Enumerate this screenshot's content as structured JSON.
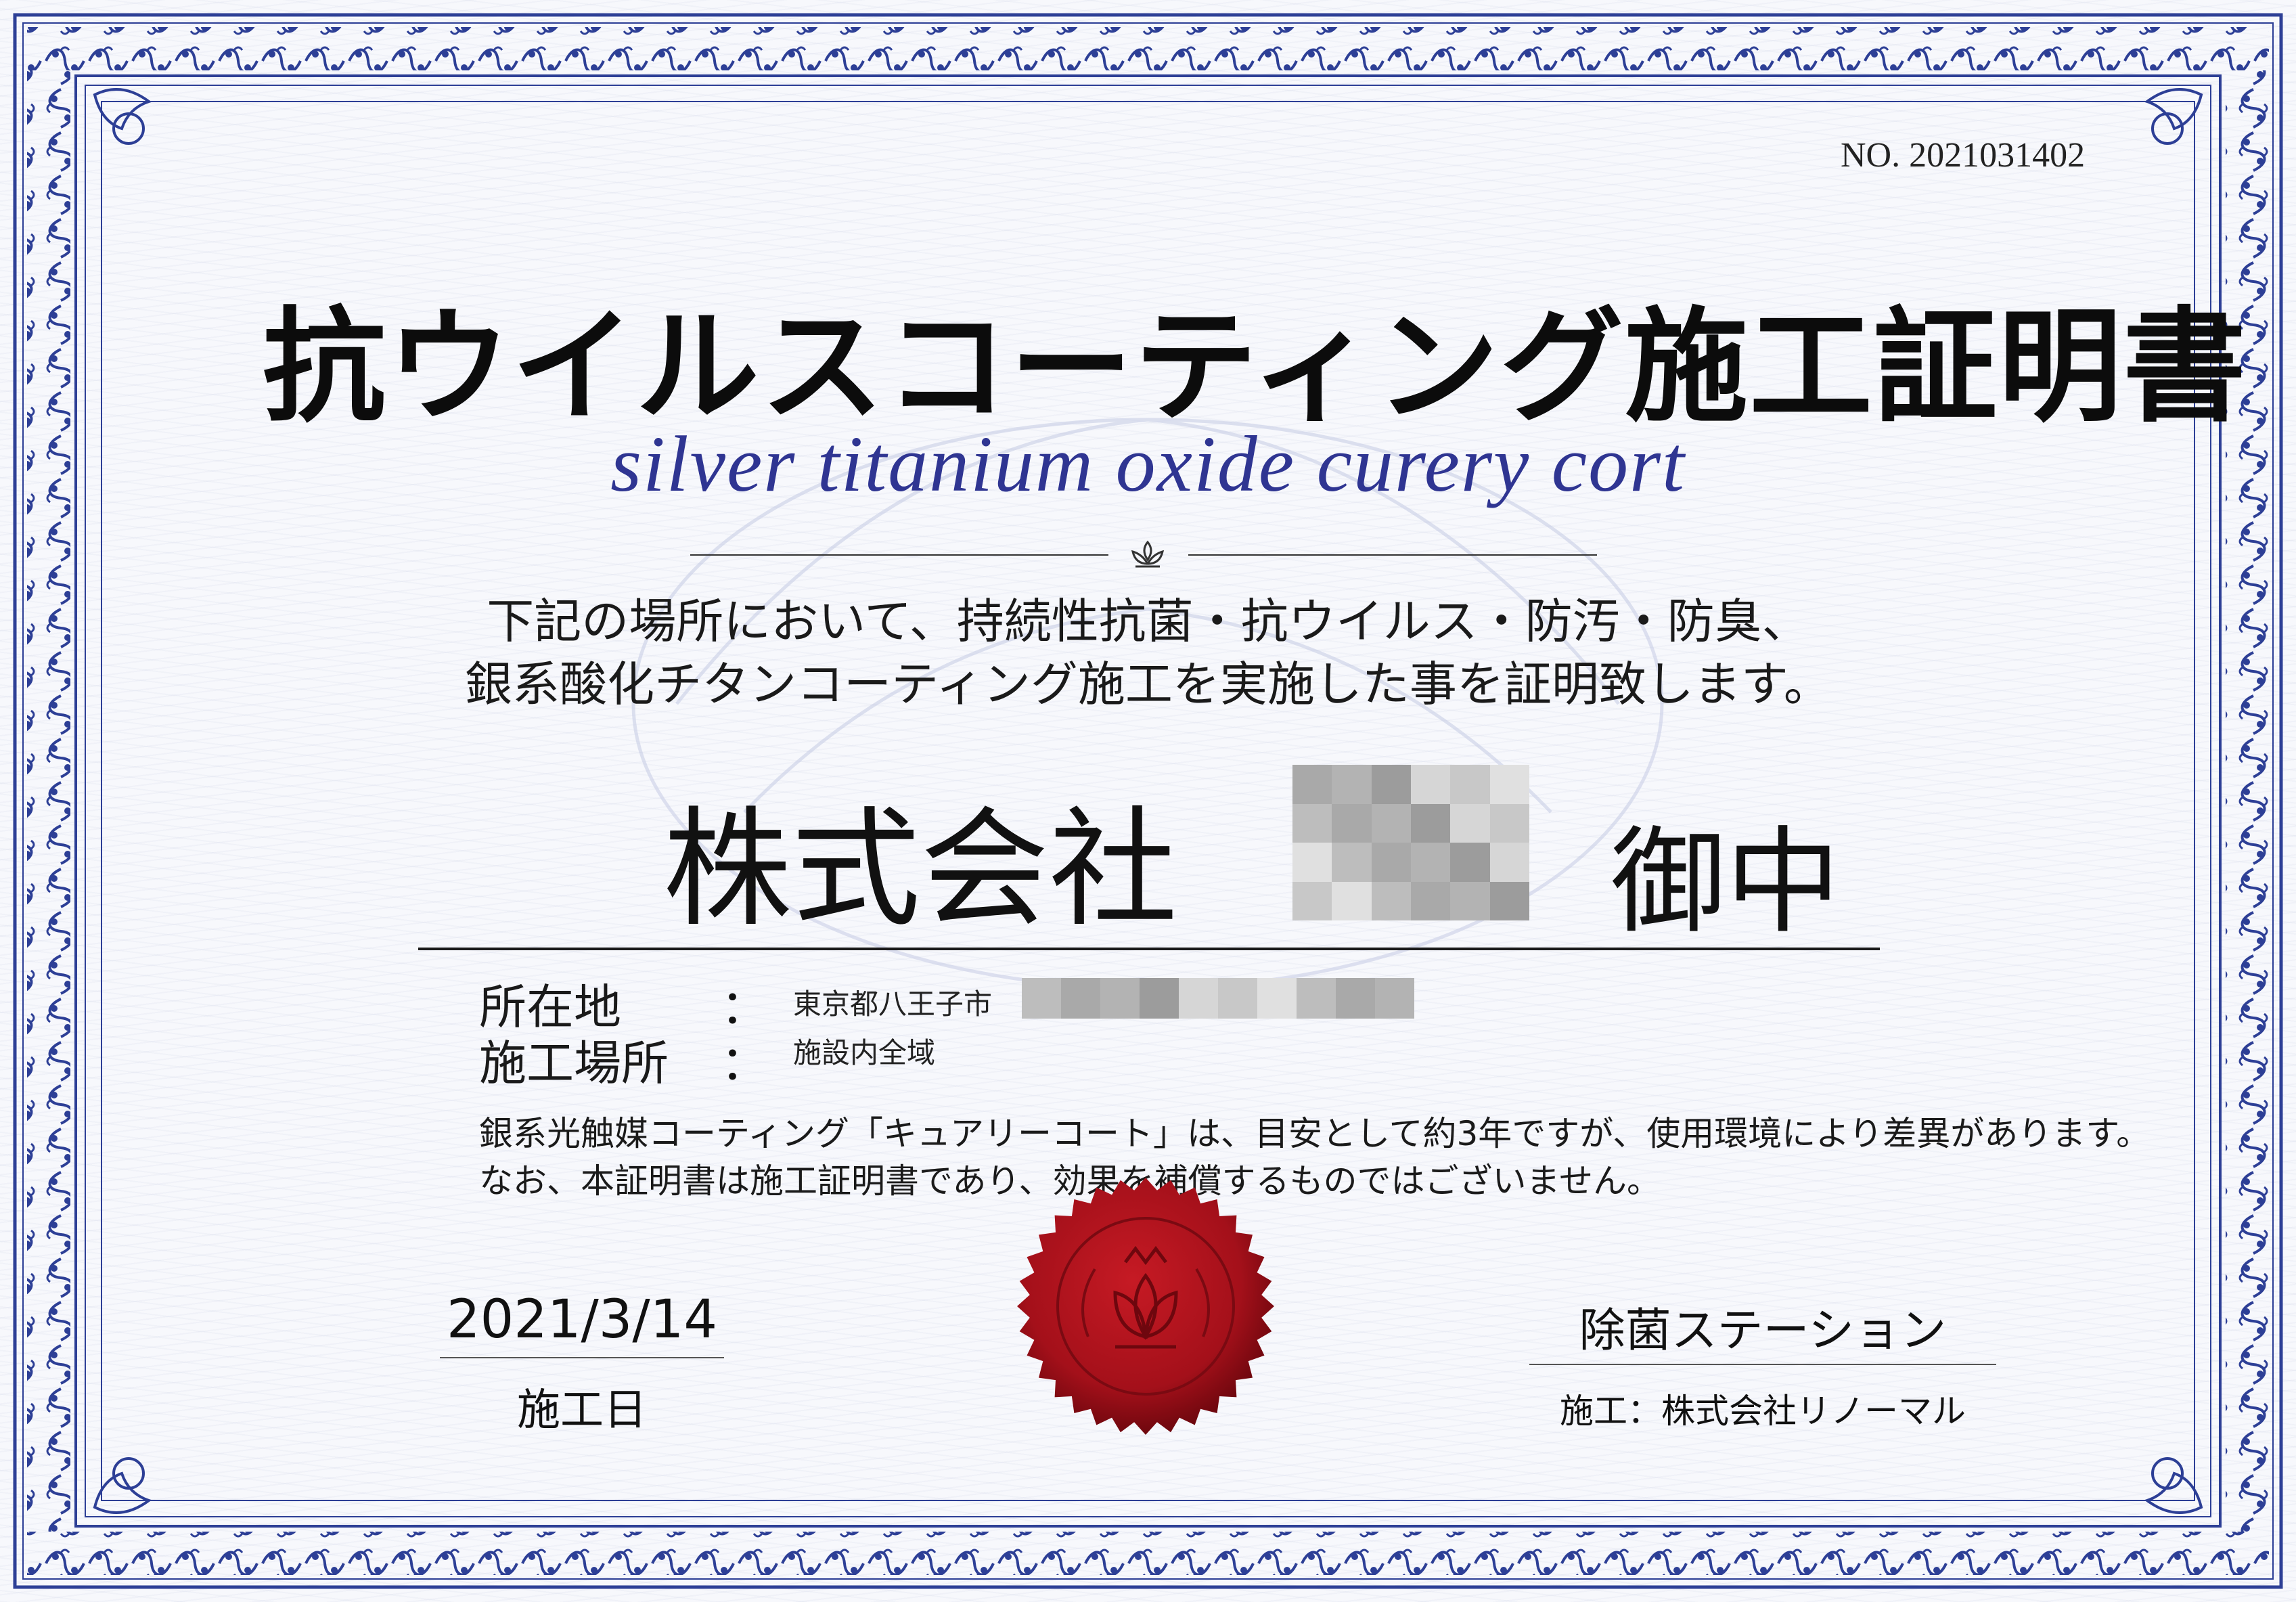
{
  "certificate": {
    "number": "NO. 2021031402",
    "title": "抗ウイルスコーティング施工証明書",
    "subtitle": "silver titanium oxide curery cort",
    "body_line1": "下記の場所において、持続性抗菌・抗ウイルス・防汚・防臭、",
    "body_line2": "銀系酸化チタンコーティング施工を実施した事を証明致します。",
    "company_prefix": "株式会社",
    "honorific": "御中",
    "location_label": "所在地",
    "location_value": "東京都八王子市",
    "site_label": "施工場所",
    "site_value": "施設内全域",
    "colon": "：",
    "note_line1": "銀系光触媒コーティング「キュアリーコート」は、目安として約3年ですが、使用環境により差異があります。",
    "note_line2": "なお、本証明書は施工証明書であり、効果を補償するものではございません。",
    "date": "2021/3/14",
    "date_label": "施工日",
    "issuer": "除菌ステーション",
    "contractor": "施工：株式会社リノーマル"
  },
  "colors": {
    "border_blue": "#2d3f96",
    "subtitle_navy": "#2f3592",
    "seal_red": "#a4101a",
    "text": "#111111"
  },
  "icons": {
    "divider_ornament": "lotus-ornament-icon",
    "seal_emblem": "lotus-crown-emblem-icon"
  }
}
